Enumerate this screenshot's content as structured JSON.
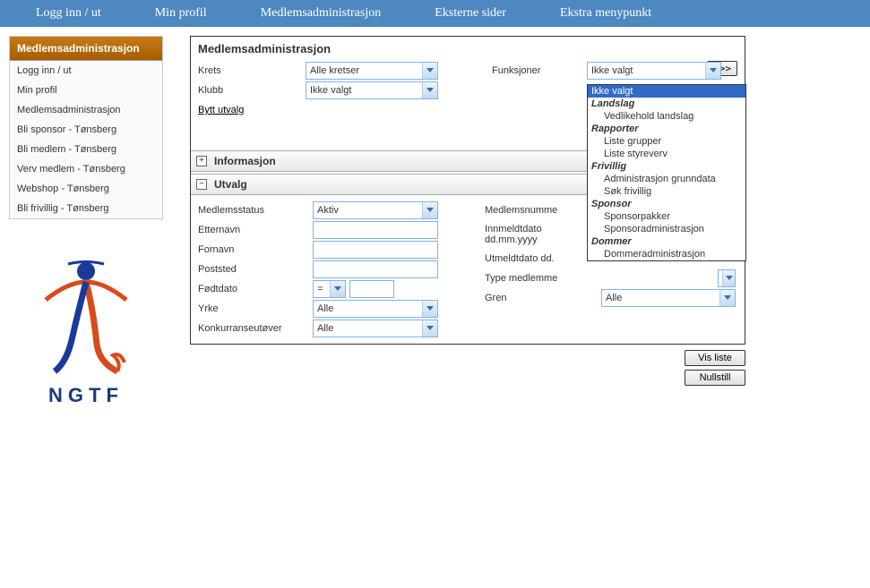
{
  "topnav": {
    "items": [
      "Logg inn / ut",
      "Min profil",
      "Medlemsadministrasjon",
      "Eksterne sider",
      "Ekstra menypunkt"
    ]
  },
  "sidebar": {
    "header": "Medlemsadministrasjon",
    "items": [
      "Logg inn / ut",
      "Min profil",
      "Medlemsadministrasjon",
      "Bli sponsor - Tønsberg",
      "Bli medlem - Tønsberg",
      "Verv medlem - Tønsberg",
      "Webshop - Tønsberg",
      "Bli frivillig - Tønsberg"
    ]
  },
  "logo": {
    "text": "NGTF"
  },
  "panel": {
    "title": "Medlemsadministrasjon",
    "top": {
      "krets_label": "Krets",
      "krets_value": "Alle kretser",
      "klubb_label": "Klubb",
      "klubb_value": "Ikke valgt",
      "bytt_utvalg": "Bytt utvalg",
      "funksjoner_label": "Funksjoner",
      "funksjoner_value": "Ikke valgt",
      "go_label": ">>>"
    },
    "sections": {
      "informasjon": "Informasjon",
      "utvalg": "Utvalg"
    },
    "utvalg": {
      "left": {
        "medlemsstatus_label": "Medlemsstatus",
        "medlemsstatus_value": "Aktiv",
        "etternavn_label": "Etternavn",
        "fornavn_label": "Fornavn",
        "poststed_label": "Poststed",
        "fodtdato_label": "Fødtdato",
        "fodtdato_op": "=",
        "yrke_label": "Yrke",
        "yrke_value": "Alle",
        "konkurranse_label": "Konkurranseutøver",
        "konkurranse_value": "Alle"
      },
      "right": {
        "medlemsnummer_label": "Medlemsnumme",
        "innmeldt_label": "Innmeldtdato dd.mm.yyyy",
        "utmeldt_label": "Utmeldtdato dd.",
        "type_label": "Type medlemme",
        "gren_label": "Gren",
        "gren_value": "Alle"
      }
    },
    "buttons": {
      "vis_liste": "Vis liste",
      "nullstill": "Nullstill"
    }
  },
  "dropdown": {
    "selected": "Ikke valgt",
    "groups": [
      {
        "title": "Landslag",
        "items": [
          "Vedlikehold landslag"
        ]
      },
      {
        "title": "Rapporter",
        "items": [
          "Liste grupper",
          "Liste styreverv"
        ]
      },
      {
        "title": "Frivillig",
        "items": [
          "Administrasjon grunndata",
          "Søk frivillig"
        ]
      },
      {
        "title": "Sponsor",
        "items": [
          "Sponsorpakker",
          "Sponsoradministrasjon"
        ]
      },
      {
        "title": "Dommer",
        "items": [
          "Dommeradministrasjon"
        ]
      }
    ]
  }
}
